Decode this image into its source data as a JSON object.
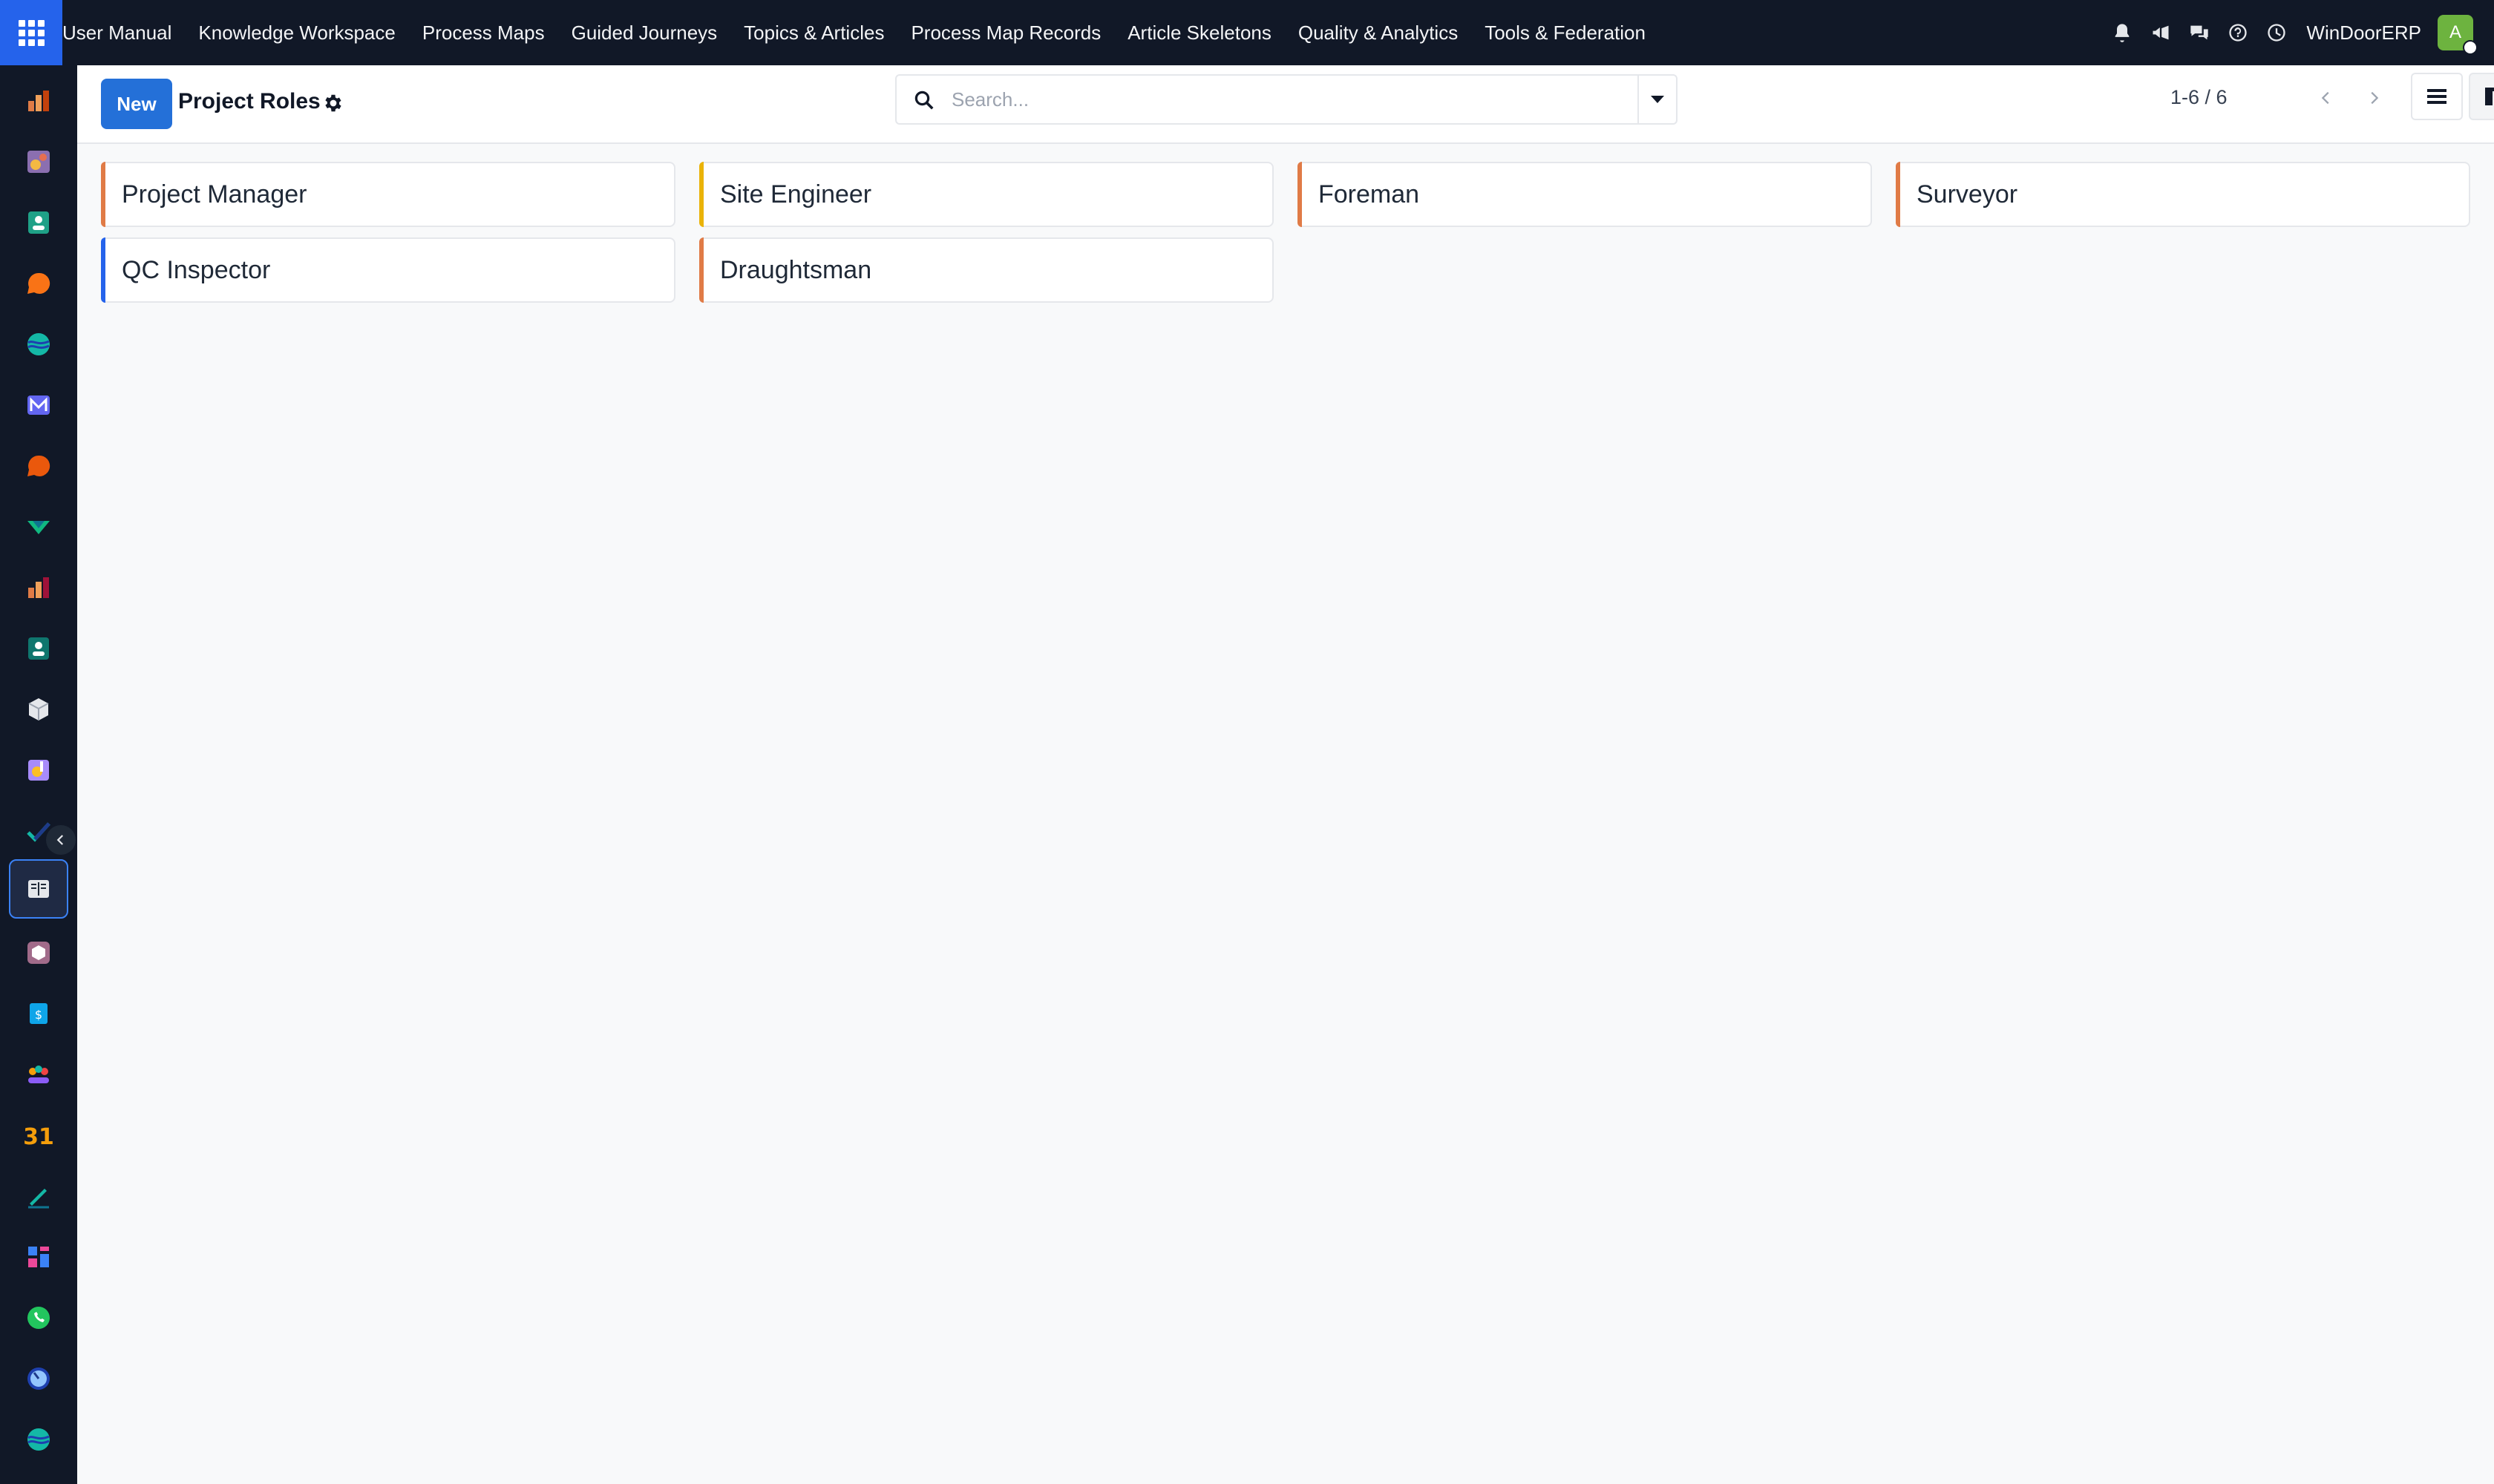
{
  "topbar": {
    "menu": [
      "User Manual",
      "Knowledge Workspace",
      "Process Maps",
      "Guided Journeys",
      "Topics & Articles",
      "Process Map Records",
      "Article Skeletons",
      "Quality & Analytics",
      "Tools & Federation"
    ],
    "icons": [
      "bell-icon",
      "megaphone-icon",
      "chat-icon",
      "help-icon",
      "clock-icon"
    ],
    "company": "WinDoorERP",
    "avatar_initial": "A",
    "avatar_color": "#6db33f"
  },
  "sidebar": {
    "apps": [
      "invoicing-icon",
      "accounting-icon",
      "contacts-icon",
      "discuss-icon",
      "web-icon",
      "mail-icon",
      "livechat-icon",
      "inventory-icon",
      "sales-icon",
      "employees-icon",
      "packages-icon",
      "settings-icon",
      "project-icon",
      "knowledge-icon",
      "product-icon",
      "expenses-icon",
      "team-icon",
      "calendar-icon",
      "sign-icon",
      "dashboards-icon",
      "whatsapp-icon",
      "timer-icon",
      "website-icon"
    ],
    "active_app": "knowledge-icon"
  },
  "control_panel": {
    "new_label": "New",
    "title": "Project Roles",
    "search_placeholder": "Search...",
    "pager": "1-6 / 6"
  },
  "cards": [
    {
      "name": "Project Manager",
      "color": "#e07b46"
    },
    {
      "name": "Site Engineer",
      "color": "#eab308"
    },
    {
      "name": "Foreman",
      "color": "#e07b46"
    },
    {
      "name": "Surveyor",
      "color": "#e07b46"
    },
    {
      "name": "QC Inspector",
      "color": "#2563eb"
    },
    {
      "name": "Draughtsman",
      "color": "#e07b46"
    }
  ],
  "colors": {
    "accent": "#2470d8",
    "navbar": "#111827"
  }
}
